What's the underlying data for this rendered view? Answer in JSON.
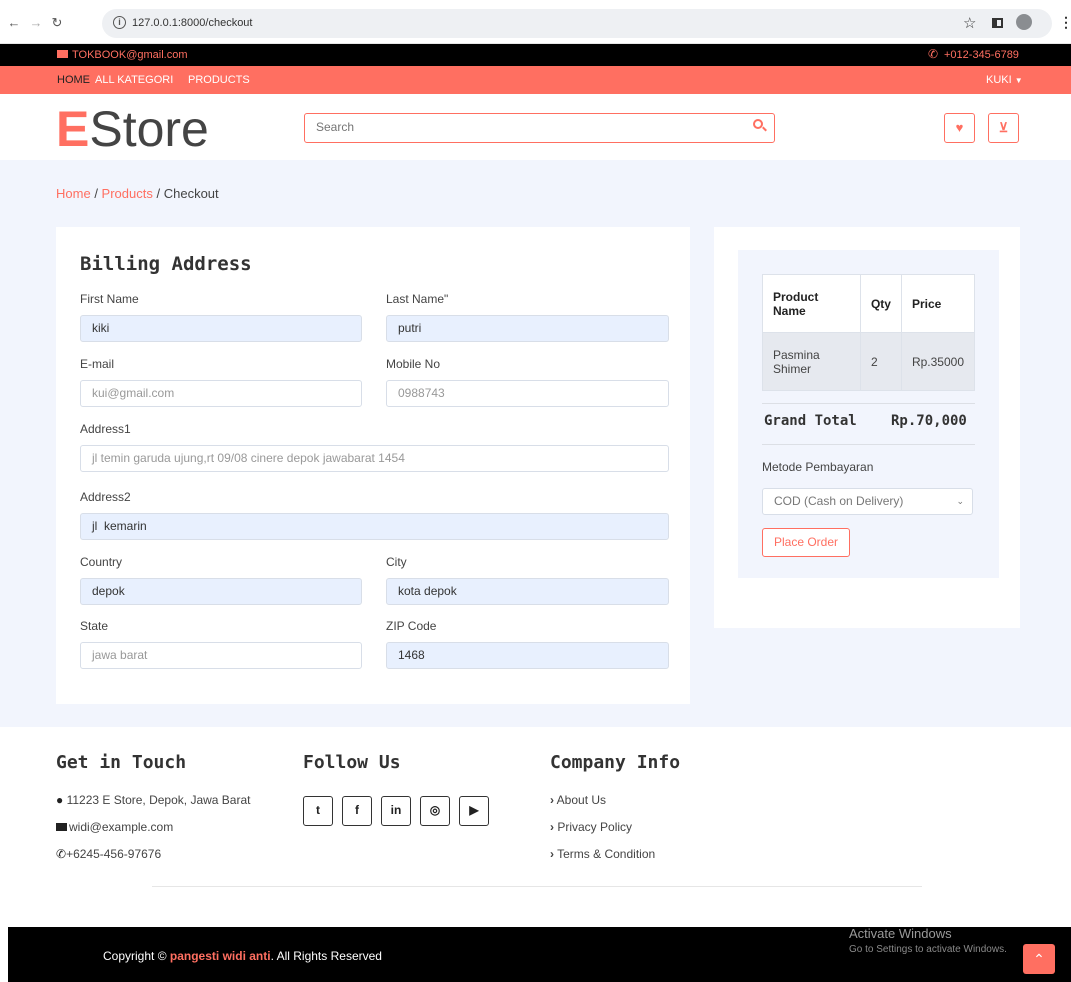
{
  "browser": {
    "url": "127.0.0.1:8000/checkout"
  },
  "topbar": {
    "email": "TOKBOOK@gmail.com",
    "phone": "+012-345-6789"
  },
  "nav": {
    "items": [
      "HOME",
      "ALL KATEGORI",
      "PRODUCTS"
    ],
    "user": "KUKI"
  },
  "header": {
    "logo_first": "E",
    "logo_rest": "Store",
    "search_placeholder": "Search"
  },
  "breadcrumb": {
    "home": "Home",
    "products": "Products",
    "current": "Checkout"
  },
  "billing": {
    "title": "Billing Address",
    "first_name": {
      "label": "First Name",
      "value": "kiki"
    },
    "last_name": {
      "label": "Last Name\"",
      "value": "putri"
    },
    "email": {
      "label": "E-mail",
      "placeholder": "kui@gmail.com"
    },
    "mobile": {
      "label": "Mobile No",
      "placeholder": "0988743"
    },
    "address1": {
      "label": "Address1",
      "placeholder": "jl temin garuda ujung,rt 09/08 cinere depok jawabarat 1454"
    },
    "address2": {
      "label": "Address2",
      "value": "jl  kemarin"
    },
    "country": {
      "label": "Country",
      "value": "depok"
    },
    "city": {
      "label": "City",
      "value": "kota depok"
    },
    "state": {
      "label": "State",
      "placeholder": "jawa barat"
    },
    "zip": {
      "label": "ZIP Code",
      "value": "1468"
    }
  },
  "summary": {
    "columns": [
      "Product Name",
      "Qty",
      "Price"
    ],
    "rows": [
      {
        "product": "Pasmina Shimer",
        "qty": "2",
        "price": "Rp.35000"
      }
    ],
    "grand_total_label": "Grand Total",
    "grand_total_value": "Rp.70,000",
    "payment_label": "Metode Pembayaran",
    "payment_selected": "COD (Cash on Delivery)",
    "place_order": "Place Order"
  },
  "footer": {
    "contact_title": "Get in Touch",
    "address": "11223 E Store, Depok, Jawa Barat",
    "email": "widi@example.com",
    "phone": "+6245-456-97676",
    "follow_title": "Follow Us",
    "company_title": "Company Info",
    "links": [
      "About Us",
      "Privacy Policy",
      "Terms & Condition"
    ],
    "copyright_prefix": "Copyright ©",
    "copyright_brand": "pangesti widi anti",
    "copyright_suffix": ". All Rights Reserved"
  },
  "windows_notice": {
    "title": "Activate Windows",
    "subtitle": "Go to Settings to activate Windows."
  },
  "colors": {
    "accent": "#ff6f61",
    "background": "#f2f5fd",
    "dark": "#000000"
  }
}
